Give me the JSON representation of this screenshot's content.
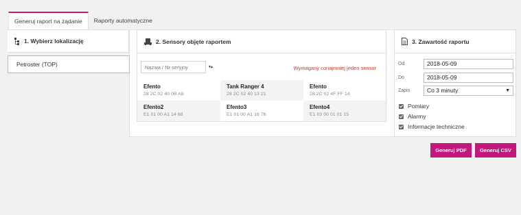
{
  "tabs": [
    {
      "label": "Generuj raport na żądanie",
      "active": true
    },
    {
      "label": "Raporty automatyczne",
      "active": false
    }
  ],
  "location_panel": {
    "title": "1. Wybierz lokalizację",
    "icon": "hierarchy-icon",
    "items": [
      "Petroster (TOP)"
    ]
  },
  "sensors_panel": {
    "title": "2. Sensory objęte raportem",
    "icon": "sensor-icon",
    "search_placeholder": "Nazwa / Nr seryjny",
    "required_message": "Wymagany conajmniej jeden sensor",
    "sensors": [
      {
        "name": "Efento",
        "serial": "28 2C 02 40 0B A8"
      },
      {
        "name": "Tank Ranger 4",
        "serial": "28 2C 02 40 13 21"
      },
      {
        "name": "Efento",
        "serial": "28 2C 02 4F FF 14"
      },
      {
        "name": "Efento2",
        "serial": "E1 01 00 A1 14 68"
      },
      {
        "name": "Efento3",
        "serial": "E1 01 00 A1 16 76"
      },
      {
        "name": "Efento4",
        "serial": "E1 03 00 01 01 15"
      }
    ]
  },
  "content_panel": {
    "title": "3. Zawartość raportu",
    "icon": "document-icon",
    "from_label": "Od",
    "from_value": "2018-05-09",
    "to_label": "Do",
    "to_value": "2018-05-09",
    "interval_label": "Zapis",
    "interval_value": "Co 3 minuty",
    "checkboxes": [
      {
        "label": "Pomiary",
        "checked": true
      },
      {
        "label": "Alarmy",
        "checked": true
      },
      {
        "label": "Informacje techniczne",
        "checked": true
      }
    ]
  },
  "buttons": {
    "pdf": "Generuj PDF",
    "csv": "Generuj CSV"
  },
  "colors": {
    "accent": "#c2187c",
    "error": "#c0392b"
  }
}
